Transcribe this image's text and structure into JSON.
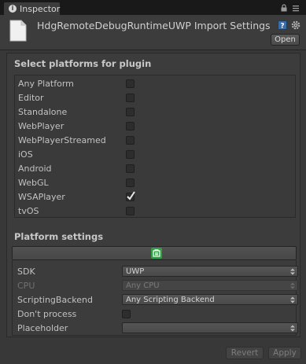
{
  "window": {
    "tab_label": "Inspector",
    "tab_icon": "info-icon"
  },
  "header": {
    "title": "HdgRemoteDebugRuntimeUWP Import Settings",
    "open_label": "Open",
    "icons": [
      "file-icon",
      "help-icon",
      "gear-icon",
      "lock-icon",
      "menu-icon"
    ]
  },
  "platforms_section": {
    "title": "Select platforms for plugin",
    "items": [
      {
        "label": "Any Platform",
        "checked": false
      },
      {
        "label": "Editor",
        "checked": false
      },
      {
        "label": "Standalone",
        "checked": false
      },
      {
        "label": "WebPlayer",
        "checked": false
      },
      {
        "label": "WebPlayerStreamed",
        "checked": false
      },
      {
        "label": "iOS",
        "checked": false
      },
      {
        "label": "Android",
        "checked": false
      },
      {
        "label": "WebGL",
        "checked": false
      },
      {
        "label": "WSAPlayer",
        "checked": true
      },
      {
        "label": "tvOS",
        "checked": false
      }
    ]
  },
  "platform_settings": {
    "title": "Platform settings",
    "active_platform_icon": "windows-store-icon",
    "sdk": {
      "label": "SDK",
      "value": "UWP"
    },
    "cpu": {
      "label": "CPU",
      "value": "Any CPU",
      "disabled": true
    },
    "scripting_backend": {
      "label": "ScriptingBackend",
      "value": "Any Scripting Backend"
    },
    "dont_process": {
      "label": "Don't process",
      "checked": false
    },
    "placeholder": {
      "label": "Placeholder",
      "value": ""
    }
  },
  "footer": {
    "revert_label": "Revert",
    "apply_label": "Apply"
  },
  "colors": {
    "background": "#383838",
    "panel": "#3c3c3c",
    "tabbar": "#191919",
    "windows_green": "#2ea043"
  }
}
